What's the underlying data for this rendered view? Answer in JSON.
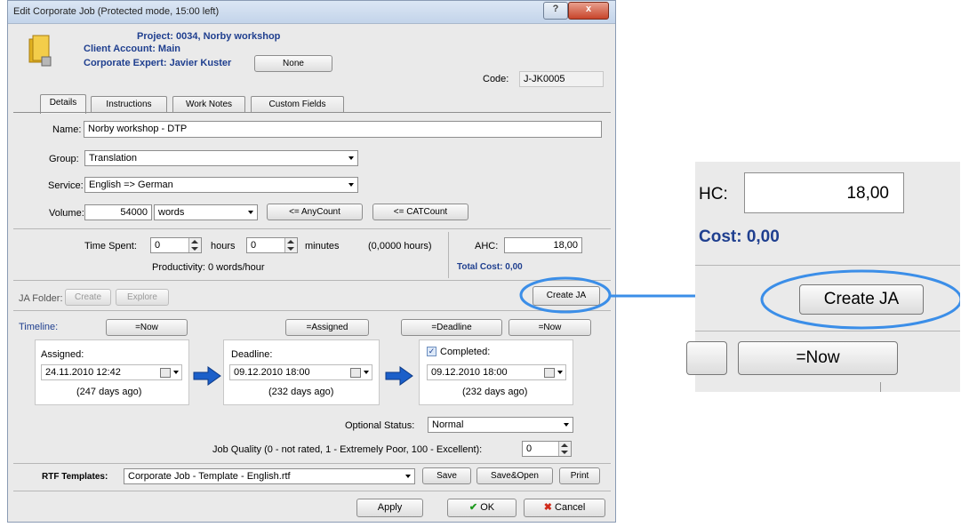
{
  "window": {
    "title": "Edit Corporate Job (Protected mode, 15:00 left)",
    "minimize_glyph": "?",
    "close_glyph": "x"
  },
  "header": {
    "project": "Project: 0034, Norby workshop",
    "client_account": "Client Account: Main",
    "corporate_expert": "Corporate Expert: Javier Kuster",
    "expert_button": "None",
    "code_label": "Code:",
    "code_value": "J-JK0005"
  },
  "tabs": [
    "Details",
    "Instructions",
    "Work Notes",
    "Custom Fields"
  ],
  "details": {
    "name_label": "Name:",
    "name_value": "Norby workshop - DTP",
    "group_label": "Group:",
    "group_value": "Translation",
    "service_label": "Service:",
    "service_value": "English => German",
    "volume_label": "Volume:",
    "volume_value": "54000",
    "unit_value": "words",
    "anycount_button": "<= AnyCount",
    "catcount_button": "<= CATCount"
  },
  "time": {
    "time_spent_label": "Time Spent:",
    "hours_value": "0",
    "hours_label": "hours",
    "minutes_value": "0",
    "minutes_label": "minutes",
    "total_hours": "(0,0000 hours)",
    "productivity": "Productivity: 0 words/hour",
    "ahc_label": "AHC:",
    "ahc_value": "18,00",
    "total_cost": "Total Cost: 0,00"
  },
  "jafolder": {
    "label": "JA Folder:",
    "create_button": "Create",
    "explore_button": "Explore",
    "create_ja_button": "Create JA"
  },
  "timeline": {
    "label": "Timeline:",
    "now_button": "=Now",
    "assigned_button": "=Assigned",
    "deadline_button": "=Deadline",
    "now_button2": "=Now",
    "assigned": {
      "label": "Assigned:",
      "date": "24.11.2010 12:42",
      "ago": "(247 days ago)"
    },
    "deadline": {
      "label": "Deadline:",
      "date": "09.12.2010 18:00",
      "ago": "(232 days ago)"
    },
    "completed": {
      "label": "Completed:",
      "date": "09.12.2010 18:00",
      "ago": "(232 days ago)",
      "checked": true
    }
  },
  "status": {
    "optional_status_label": "Optional Status:",
    "optional_status_value": "Normal",
    "job_quality_label": "Job Quality (0 - not rated, 1 - Extremely Poor, 100 - Excellent):",
    "job_quality_value": "0"
  },
  "rtf": {
    "label": "RTF Templates:",
    "template_value": "Corporate Job - Template - English.rtf",
    "save_button": "Save",
    "save_open_button": "Save&Open",
    "print_button": "Print"
  },
  "footer": {
    "apply_button": "Apply",
    "ok_button": "OK",
    "cancel_button": "Cancel"
  },
  "zoom": {
    "ahc_label": "HC:",
    "ahc_value": "18,00",
    "cost": "Cost: 0,00",
    "create_ja_button": "Create JA",
    "now_button": "=Now"
  },
  "colors": {
    "highlight": "#3b8ee8",
    "label_blue": "#1f3f8f",
    "arrow_blue": "#1b5fc9"
  }
}
